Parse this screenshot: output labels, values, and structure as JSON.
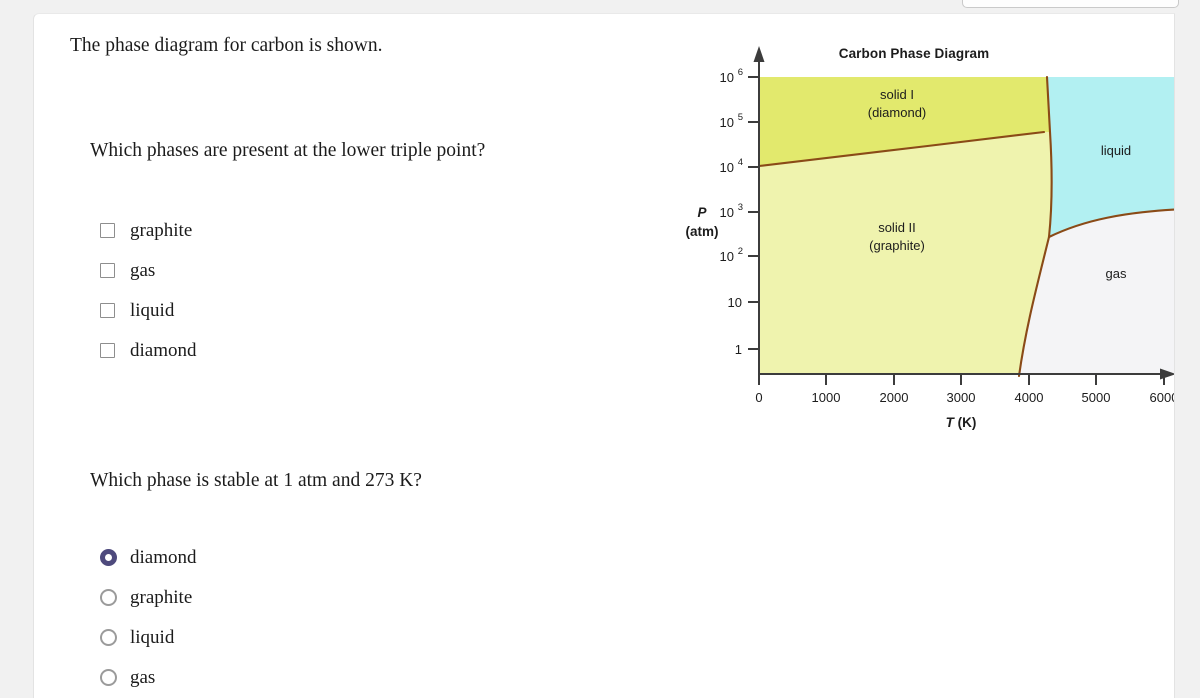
{
  "page": {
    "background_color": "#f1f1f1",
    "card_color": "#ffffff"
  },
  "intro": {
    "text": "The phase diagram for carbon is shown."
  },
  "question_1": {
    "text": "Which phases are present at the lower triple point?",
    "input_type": "checkbox",
    "options": [
      {
        "label": "graphite",
        "checked": false
      },
      {
        "label": "gas",
        "checked": false
      },
      {
        "label": "liquid",
        "checked": false
      },
      {
        "label": "diamond",
        "checked": false
      }
    ]
  },
  "question_2": {
    "text": "Which phase is stable at 1 atm and 273 K?",
    "input_type": "radio",
    "selected": "diamond",
    "selected_color": "#4e4a7d",
    "options": [
      {
        "label": "diamond",
        "checked": true
      },
      {
        "label": "graphite",
        "checked": false
      },
      {
        "label": "liquid",
        "checked": false
      },
      {
        "label": "gas",
        "checked": false
      }
    ]
  },
  "chart_data": {
    "type": "line",
    "title": "Carbon Phase Diagram",
    "xlabel": "T (K)",
    "xlabel_italic_part": "T",
    "xlabel_rest": " (K)",
    "ylabel": "P (atm)",
    "ylabel_line1": "P",
    "ylabel_line2": "(atm)",
    "xlim": [
      0,
      6300
    ],
    "ylim_log_decades": [
      -0.4,
      6.3
    ],
    "grid": false,
    "legend": "none",
    "x_ticks": [
      "0",
      "1000",
      "2000",
      "3000",
      "4000",
      "5000",
      "6000"
    ],
    "x_tick_values": [
      0,
      1000,
      2000,
      3000,
      4000,
      5000,
      6000
    ],
    "y_ticks": [
      {
        "base": "10",
        "exp": "6",
        "value": 1000000
      },
      {
        "base": "10",
        "exp": "5",
        "value": 100000
      },
      {
        "base": "10",
        "exp": "4",
        "value": 10000
      },
      {
        "base": "10",
        "exp": "3",
        "value": 1000
      },
      {
        "base": "10",
        "exp": "2",
        "value": 100
      },
      {
        "base": "10",
        "exp": "",
        "value": 10
      },
      {
        "base": "1",
        "exp": "",
        "value": 1
      }
    ],
    "regions": [
      {
        "name": "solid I (diamond)",
        "label_line1": "solid I",
        "label_line2": "(diamond)",
        "color": "#e2e96d"
      },
      {
        "name": "solid II (graphite)",
        "label_line1": "solid II",
        "label_line2": "(graphite)",
        "color": "#eff3ae"
      },
      {
        "name": "liquid",
        "label_line1": "liquid",
        "label_line2": "",
        "color": "#b2f0f2"
      },
      {
        "name": "gas",
        "label_line1": "gas",
        "label_line2": "",
        "color": "#f4f4f6"
      }
    ],
    "boundary_color": "#8a4a17",
    "axis_color": "#3c3c3c",
    "boundaries": [
      {
        "name": "diamond-graphite",
        "points": [
          [
            0,
            18000
          ],
          [
            1000,
            27000
          ],
          [
            2000,
            42000
          ],
          [
            3000,
            62000
          ],
          [
            3900,
            95000
          ],
          [
            4150,
            105000
          ]
        ]
      },
      {
        "name": "diamond/graphite-liquid",
        "points": [
          [
            4150,
            1000000
          ],
          [
            4120,
            105000
          ],
          [
            4170,
            10000
          ],
          [
            4200,
            500
          ]
        ]
      },
      {
        "name": "graphite-gas (sublimation)",
        "points": [
          [
            4200,
            500
          ],
          [
            4100,
            50
          ],
          [
            3950,
            3
          ],
          [
            3830,
            0.4
          ]
        ]
      },
      {
        "name": "liquid-gas (vaporization)",
        "points": [
          [
            4200,
            500
          ],
          [
            4600,
            1100
          ],
          [
            5200,
            1600
          ],
          [
            6300,
            1850
          ]
        ]
      }
    ],
    "triple_points": [
      {
        "name": "lower triple point (graphite-liquid-gas)",
        "T": 4200,
        "P": 500
      },
      {
        "name": "upper triple point (diamond-graphite-liquid)",
        "T": 4130,
        "P": 105000
      }
    ]
  }
}
